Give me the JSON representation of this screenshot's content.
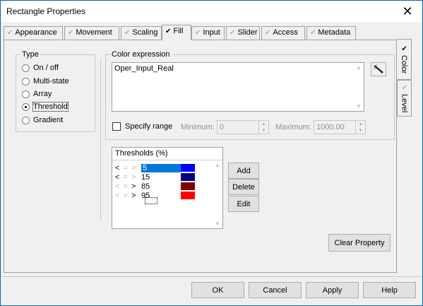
{
  "window": {
    "title": "Rectangle Properties"
  },
  "tabs": [
    {
      "label": "Appearance",
      "checked": false
    },
    {
      "label": "Movement",
      "checked": false
    },
    {
      "label": "Scaling",
      "checked": false
    },
    {
      "label": "Fill",
      "checked": true
    },
    {
      "label": "Input",
      "checked": false
    },
    {
      "label": "Slider",
      "checked": false
    },
    {
      "label": "Access",
      "checked": false
    },
    {
      "label": "Metadata",
      "checked": false
    }
  ],
  "side_tabs": [
    {
      "label": "Color",
      "checked": true
    },
    {
      "label": "Level",
      "checked": false
    }
  ],
  "type_group": {
    "title": "Type",
    "options": [
      "On / off",
      "Multi-state",
      "Array",
      "Threshold",
      "Gradient"
    ],
    "selected": "Threshold"
  },
  "color_expression": {
    "title": "Color expression",
    "value": "Oper_Input_Real"
  },
  "range": {
    "specify_label": "Specify range",
    "checked": false,
    "minimum_label": "Minimum:",
    "minimum_value": "0",
    "maximum_label": "Maximum:",
    "maximum_value": "1000.00"
  },
  "thresholds": {
    "title": "Thresholds (%)",
    "rows": [
      {
        "op_strong": "<",
        "op_faint": "= >",
        "value": "5",
        "color": "#0000ff",
        "selected": true
      },
      {
        "op_strong": "<",
        "op_faint": "= >",
        "value": "15",
        "color": "#000080",
        "selected": false
      },
      {
        "op_strong": ">",
        "op_faint": "< =",
        "value": "85",
        "color": "#800000",
        "selected": false
      },
      {
        "op_strong": ">",
        "op_faint": "< =",
        "value": "95",
        "color": "#ff0000",
        "selected": false
      }
    ]
  },
  "threshold_buttons": {
    "add": "Add",
    "delete": "Delete",
    "edit": "Edit"
  },
  "clear_property": "Clear Property",
  "footer": {
    "ok": "OK",
    "cancel": "Cancel",
    "apply": "Apply",
    "help": "Help"
  }
}
